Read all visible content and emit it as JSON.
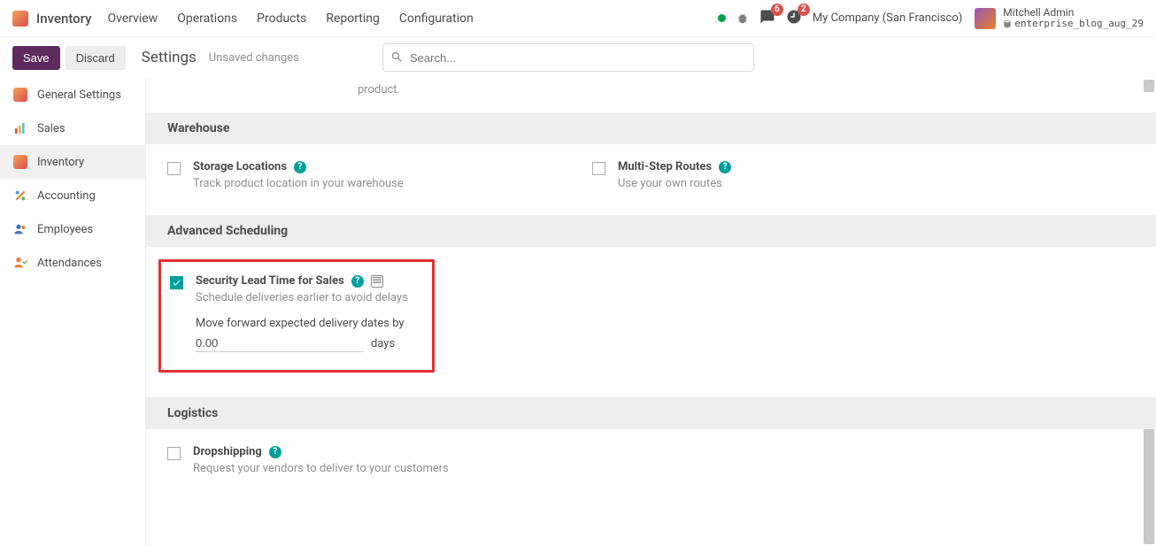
{
  "app": {
    "name": "Inventory"
  },
  "topmenu": [
    "Overview",
    "Operations",
    "Products",
    "Reporting",
    "Configuration"
  ],
  "badges": {
    "chat": "6",
    "bell": "2"
  },
  "company": "My Company (San Francisco)",
  "user": {
    "name": "Mitchell Admin",
    "db": "enterprise_blog_aug_29"
  },
  "controls": {
    "save": "Save",
    "discard": "Discard",
    "title": "Settings",
    "unsaved": "Unsaved changes",
    "search_placeholder": "Search..."
  },
  "sidebar": [
    {
      "label": "General Settings"
    },
    {
      "label": "Sales"
    },
    {
      "label": "Inventory",
      "active": true
    },
    {
      "label": "Accounting"
    },
    {
      "label": "Employees"
    },
    {
      "label": "Attendances"
    }
  ],
  "partial_desc": "product.",
  "sections": {
    "warehouse": {
      "title": "Warehouse",
      "storage": {
        "title": "Storage Locations",
        "desc": "Track product location in your warehouse"
      },
      "routes": {
        "title": "Multi-Step Routes",
        "desc": "Use your own routes"
      }
    },
    "scheduling": {
      "title": "Advanced Scheduling",
      "lead": {
        "title": "Security Lead Time for Sales",
        "desc": "Schedule deliveries earlier to avoid delays",
        "subfield_label": "Move forward expected delivery dates by",
        "value": "0.00",
        "unit": "days"
      }
    },
    "logistics": {
      "title": "Logistics",
      "dropship": {
        "title": "Dropshipping",
        "desc": "Request your vendors to deliver to your customers"
      }
    }
  }
}
